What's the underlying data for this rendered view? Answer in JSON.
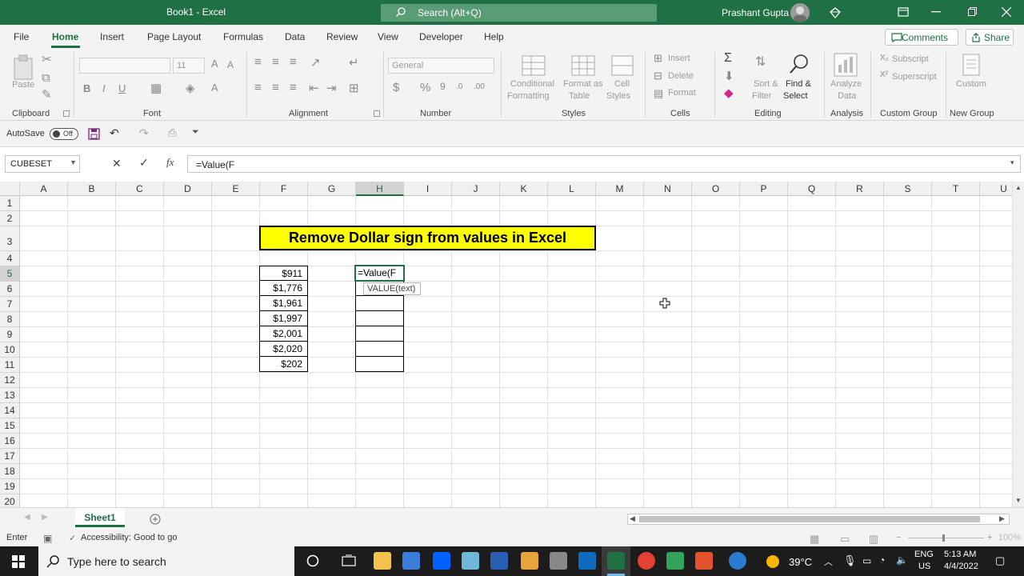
{
  "window": {
    "title": "Book1  -  Excel",
    "search_placeholder": "Search (Alt+Q)",
    "user_name": "Prashant Gupta"
  },
  "tabs": [
    "File",
    "Home",
    "Insert",
    "Page Layout",
    "Formulas",
    "Data",
    "Review",
    "View",
    "Developer",
    "Help"
  ],
  "active_tab": "Home",
  "actions": {
    "comments": "Comments",
    "share": "Share"
  },
  "ribbon": {
    "groups": [
      "Clipboard",
      "Font",
      "Alignment",
      "Number",
      "Styles",
      "Cells",
      "Editing",
      "Analysis",
      "Custom Group",
      "New Group"
    ],
    "paste": "Paste",
    "font_size": "11",
    "number_format": "General",
    "conditional_formatting": [
      "Conditional",
      "Formatting"
    ],
    "format_as_table": [
      "Format as",
      "Table"
    ],
    "cell_styles": [
      "Cell",
      "Styles"
    ],
    "insert": "Insert",
    "delete": "Delete",
    "format": "Format",
    "sort_filter": [
      "Sort &",
      "Filter"
    ],
    "find_select": [
      "Find &",
      "Select"
    ],
    "analyze_data": [
      "Analyze",
      "Data"
    ],
    "subscript": "Subscript",
    "superscript": "Superscript",
    "custom": "Custom"
  },
  "qat": {
    "autosave": "AutoSave",
    "autosave_state": "Off"
  },
  "formula_bar": {
    "name_box": "CUBESET",
    "formula": "=Value(F"
  },
  "columns": [
    "A",
    "B",
    "C",
    "D",
    "E",
    "F",
    "G",
    "H",
    "I",
    "J",
    "K",
    "L",
    "M",
    "N",
    "O",
    "P",
    "Q",
    "R",
    "S",
    "T",
    "U"
  ],
  "selected_column": "H",
  "rows": [
    "1",
    "2",
    "3",
    "4",
    "5",
    "6",
    "7",
    "8",
    "9",
    "10",
    "11",
    "12",
    "13",
    "14",
    "15",
    "16",
    "17",
    "18",
    "19",
    "20"
  ],
  "selected_row": "5",
  "sheet": {
    "title": "Remove Dollar sign from values in Excel",
    "values_f": [
      "$911",
      "$1,776",
      "$1,961",
      "$1,997",
      "$2,001",
      "$2,020",
      "$202"
    ],
    "active_cell_text": "=Value(F",
    "tooltip": "VALUE(text)"
  },
  "sheet_tabs": [
    "Sheet1"
  ],
  "status": {
    "mode": "Enter",
    "accessibility": "Accessibility: Good to go",
    "zoom": "100%"
  },
  "taskbar": {
    "search_placeholder": "Type here to search",
    "temperature": "39°C",
    "language": [
      "ENG",
      "US"
    ],
    "time": "5:13 AM",
    "date": "4/4/2022"
  }
}
